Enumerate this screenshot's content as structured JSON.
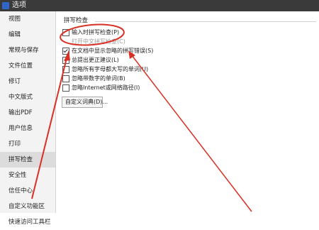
{
  "window": {
    "title": "选项",
    "icon": "app-logo-icon"
  },
  "sidebar": {
    "items": [
      {
        "label": "视图"
      },
      {
        "label": "编辑"
      },
      {
        "label": "常规与保存"
      },
      {
        "label": "文件位置"
      },
      {
        "label": "修订"
      },
      {
        "label": "中文版式"
      },
      {
        "label": "输出PDF"
      },
      {
        "label": "用户信息"
      },
      {
        "label": "打印"
      },
      {
        "label": "拼写检查",
        "selected": true
      },
      {
        "label": "安全性"
      },
      {
        "label": "信任中心"
      },
      {
        "label": "自定义功能区"
      },
      {
        "label": "快速访问工具栏"
      }
    ]
  },
  "spell_check": {
    "section_title": "拼写检查",
    "options": [
      {
        "label": "输入时拼写检查(P)",
        "checked": false,
        "enabled": true
      },
      {
        "label": "打开中文拼写检查(C)",
        "checked": false,
        "enabled": false
      },
      {
        "label": "在文档中显示忽略的拼写错误(S)",
        "checked": true,
        "enabled": true
      },
      {
        "label": "总提出更正建议(L)",
        "checked": false,
        "enabled": true
      },
      {
        "label": "忽略所有字母都大写的单词(U)",
        "checked": false,
        "enabled": true
      },
      {
        "label": "忽略带数字的单词(B)",
        "checked": false,
        "enabled": true
      },
      {
        "label": "忽略Internet或网络路径(I)",
        "checked": false,
        "enabled": true
      }
    ],
    "custom_dictionary_button": "自定义词典(D)..."
  },
  "annotations": {
    "color": "#d93025"
  }
}
